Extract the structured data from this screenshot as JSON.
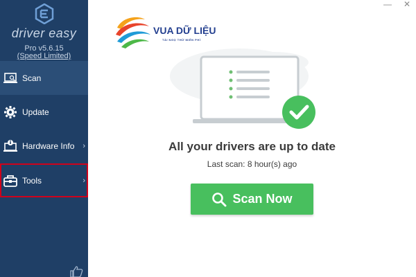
{
  "brand": {
    "name": "driver easy",
    "version": "Pro v5.6.15",
    "edition_link": "(Speed Limited)"
  },
  "sidebar": {
    "items": [
      {
        "label": "Scan",
        "icon": "scan-icon",
        "active": true
      },
      {
        "label": "Update",
        "icon": "gear-icon"
      },
      {
        "label": "Hardware Info",
        "icon": "hardware-info-icon",
        "has_submenu": true
      },
      {
        "label": "Tools",
        "icon": "toolbox-icon",
        "has_submenu": true,
        "highlighted": true
      }
    ],
    "chevron": "›"
  },
  "window": {
    "minimize": "—",
    "close": "✕"
  },
  "watermark": {
    "title": "VUA DỮ LIỆU",
    "subtitle": "TÀI NGỌ THỬ MIỄN PHÍ"
  },
  "main": {
    "headline": "All your drivers are up to date",
    "last_scan": "Last scan: 8 hour(s) ago",
    "scan_button": "Scan Now"
  },
  "colors": {
    "sidebar_bg": "#1f3f66",
    "sidebar_active": "#2b4e77",
    "accent_green": "#48bf5e",
    "highlight_red": "#d0021b"
  }
}
